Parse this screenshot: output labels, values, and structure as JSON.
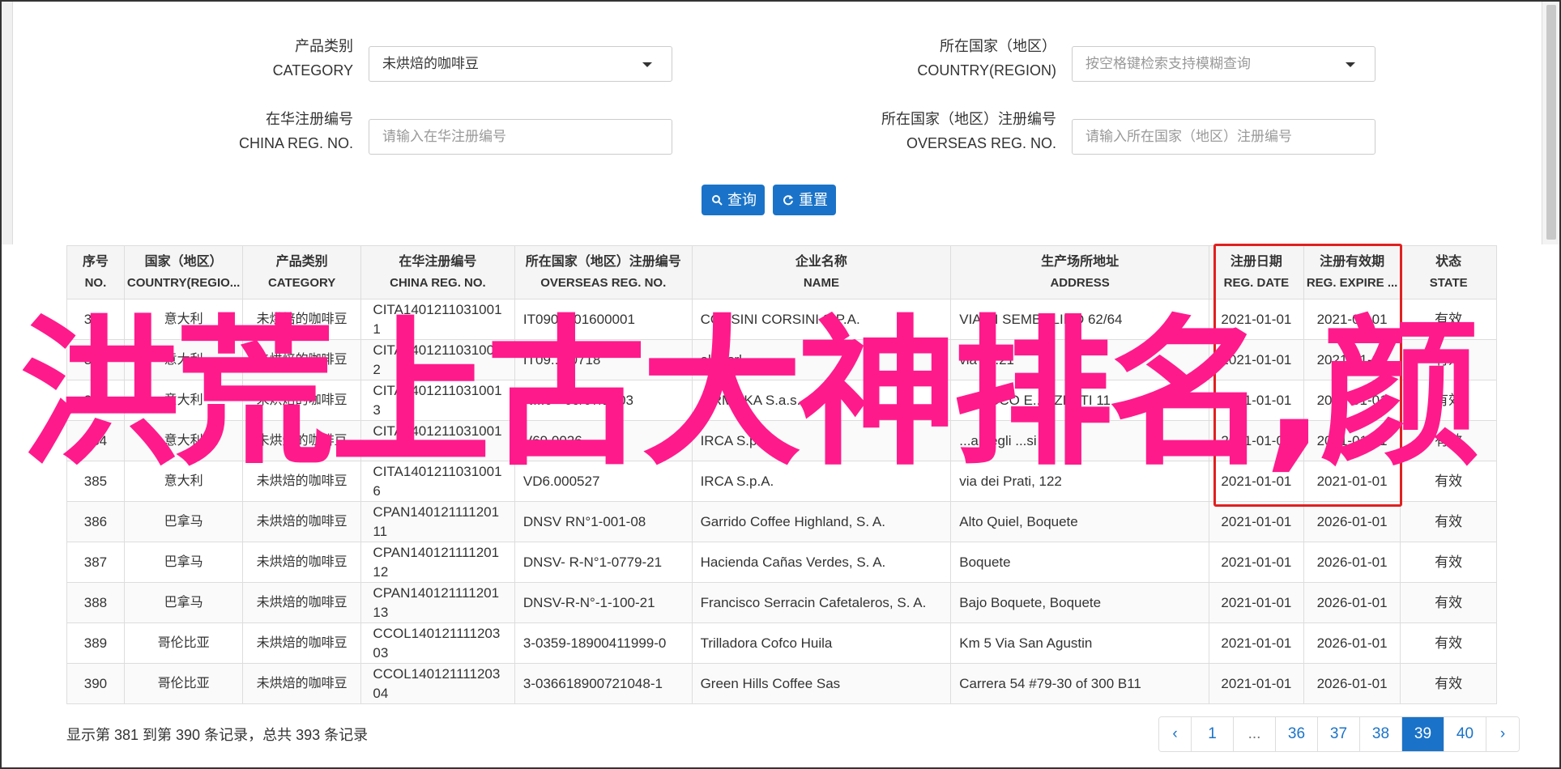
{
  "form": {
    "category": {
      "label_zh": "产品类别",
      "label_en": "CATEGORY",
      "value": "未烘焙的咖啡豆"
    },
    "country": {
      "label_zh": "所在国家（地区）",
      "label_en": "COUNTRY(REGION)",
      "placeholder": "按空格键检索支持模糊查询"
    },
    "china_reg": {
      "label_zh": "在华注册编号",
      "label_en": "CHINA REG. NO.",
      "placeholder": "请输入在华注册编号"
    },
    "overseas_reg": {
      "label_zh": "所在国家（地区）注册编号",
      "label_en": "OVERSEAS REG. NO.",
      "placeholder": "请输入所在国家（地区）注册编号"
    },
    "query_button": "查询",
    "reset_button": "重置"
  },
  "table": {
    "headers": [
      {
        "zh": "序号",
        "en": "NO."
      },
      {
        "zh": "国家（地区）",
        "en": "COUNTRY(REGIO..."
      },
      {
        "zh": "产品类别",
        "en": "CATEGORY"
      },
      {
        "zh": "在华注册编号",
        "en": "CHINA REG. NO."
      },
      {
        "zh": "所在国家（地区）注册编号",
        "en": "OVERSEAS REG. NO."
      },
      {
        "zh": "企业名称",
        "en": "NAME"
      },
      {
        "zh": "生产场所地址",
        "en": "ADDRESS"
      },
      {
        "zh": "注册日期",
        "en": "REG. DATE"
      },
      {
        "zh": "注册有效期",
        "en": "REG. EXPIRE ..."
      },
      {
        "zh": "状态",
        "en": "STATE"
      }
    ],
    "rows": [
      [
        "381",
        "意大利",
        "未烘焙的咖啡豆",
        "CITA14012110310011",
        "IT0905101600001",
        "CORSINI CORSINI S.P.A.",
        "VIA DI SEMBOLINO 62/64",
        "2021-01-01",
        "2021-01-01",
        "有效"
      ],
      [
        "382",
        "意大利",
        "未烘焙的咖啡豆",
        "CITA14012110310012",
        "IT09...00718",
        "alvi’ srl",
        "via T...21",
        "2021-01-01",
        "2021-01-01",
        "有效"
      ],
      [
        "383",
        "意大利",
        "未烘焙的咖啡豆",
        "CITA14012110310013",
        "N...0 - 09/07/2003",
        "...RMOKA S.a.s.",
        "...SACCO E...NZETTI 11",
        "2021-01-01",
        "2021-01-01",
        "有效"
      ],
      [
        "384",
        "意大利",
        "未烘焙的咖啡豆",
        "CITA14012110310014",
        "V69.0026...",
        "IRCA S.p.A.",
        "...a degli ...si 5",
        "2021-01-01",
        "2021-01-01",
        "有效"
      ],
      [
        "385",
        "意大利",
        "未烘焙的咖啡豆",
        "CITA14012110310016",
        "VD6.000527",
        "IRCA S.p.A.",
        "via dei Prati, 122",
        "2021-01-01",
        "2021-01-01",
        "有效"
      ],
      [
        "386",
        "巴拿马",
        "未烘焙的咖啡豆",
        "CPAN14012111120111",
        "DNSV RN°1-001-08",
        "Garrido Coffee Highland, S. A.",
        "Alto Quiel, Boquete",
        "2021-01-01",
        "2026-01-01",
        "有效"
      ],
      [
        "387",
        "巴拿马",
        "未烘焙的咖啡豆",
        "CPAN14012111120112",
        "DNSV- R-N°1-0779-21",
        "Hacienda Cañas Verdes, S. A.",
        "Boquete",
        "2021-01-01",
        "2026-01-01",
        "有效"
      ],
      [
        "388",
        "巴拿马",
        "未烘焙的咖啡豆",
        "CPAN14012111120113",
        "DNSV-R-N°-1-100-21",
        "Francisco Serracin Cafetaleros, S. A.",
        "Bajo Boquete, Boquete",
        "2021-01-01",
        "2026-01-01",
        "有效"
      ],
      [
        "389",
        "哥伦比亚",
        "未烘焙的咖啡豆",
        "CCOL14012111120303",
        "3-0359-18900411999-0",
        "Trilladora Cofco Huila",
        "Km 5 Via San Agustin",
        "2021-01-01",
        "2026-01-01",
        "有效"
      ],
      [
        "390",
        "哥伦比亚",
        "未烘焙的咖啡豆",
        "CCOL14012111120304",
        "3-036618900721048-1",
        "Green Hills Coffee Sas",
        "Carrera 54 #79-30 of 300 B11",
        "2021-01-01",
        "2026-01-01",
        "有效"
      ]
    ]
  },
  "summary": "显示第 381 到第 390 条记录，总共 393 条记录",
  "pagination": [
    "‹",
    "1",
    "...",
    "36",
    "37",
    "38",
    "39",
    "40",
    "›"
  ],
  "pagination_active": "39",
  "watermark": "洪荒上古大神排名,颜",
  "colors": {
    "primary": "#1a73c8",
    "highlight_box": "#e02020",
    "watermark": "#ff1a8c"
  }
}
